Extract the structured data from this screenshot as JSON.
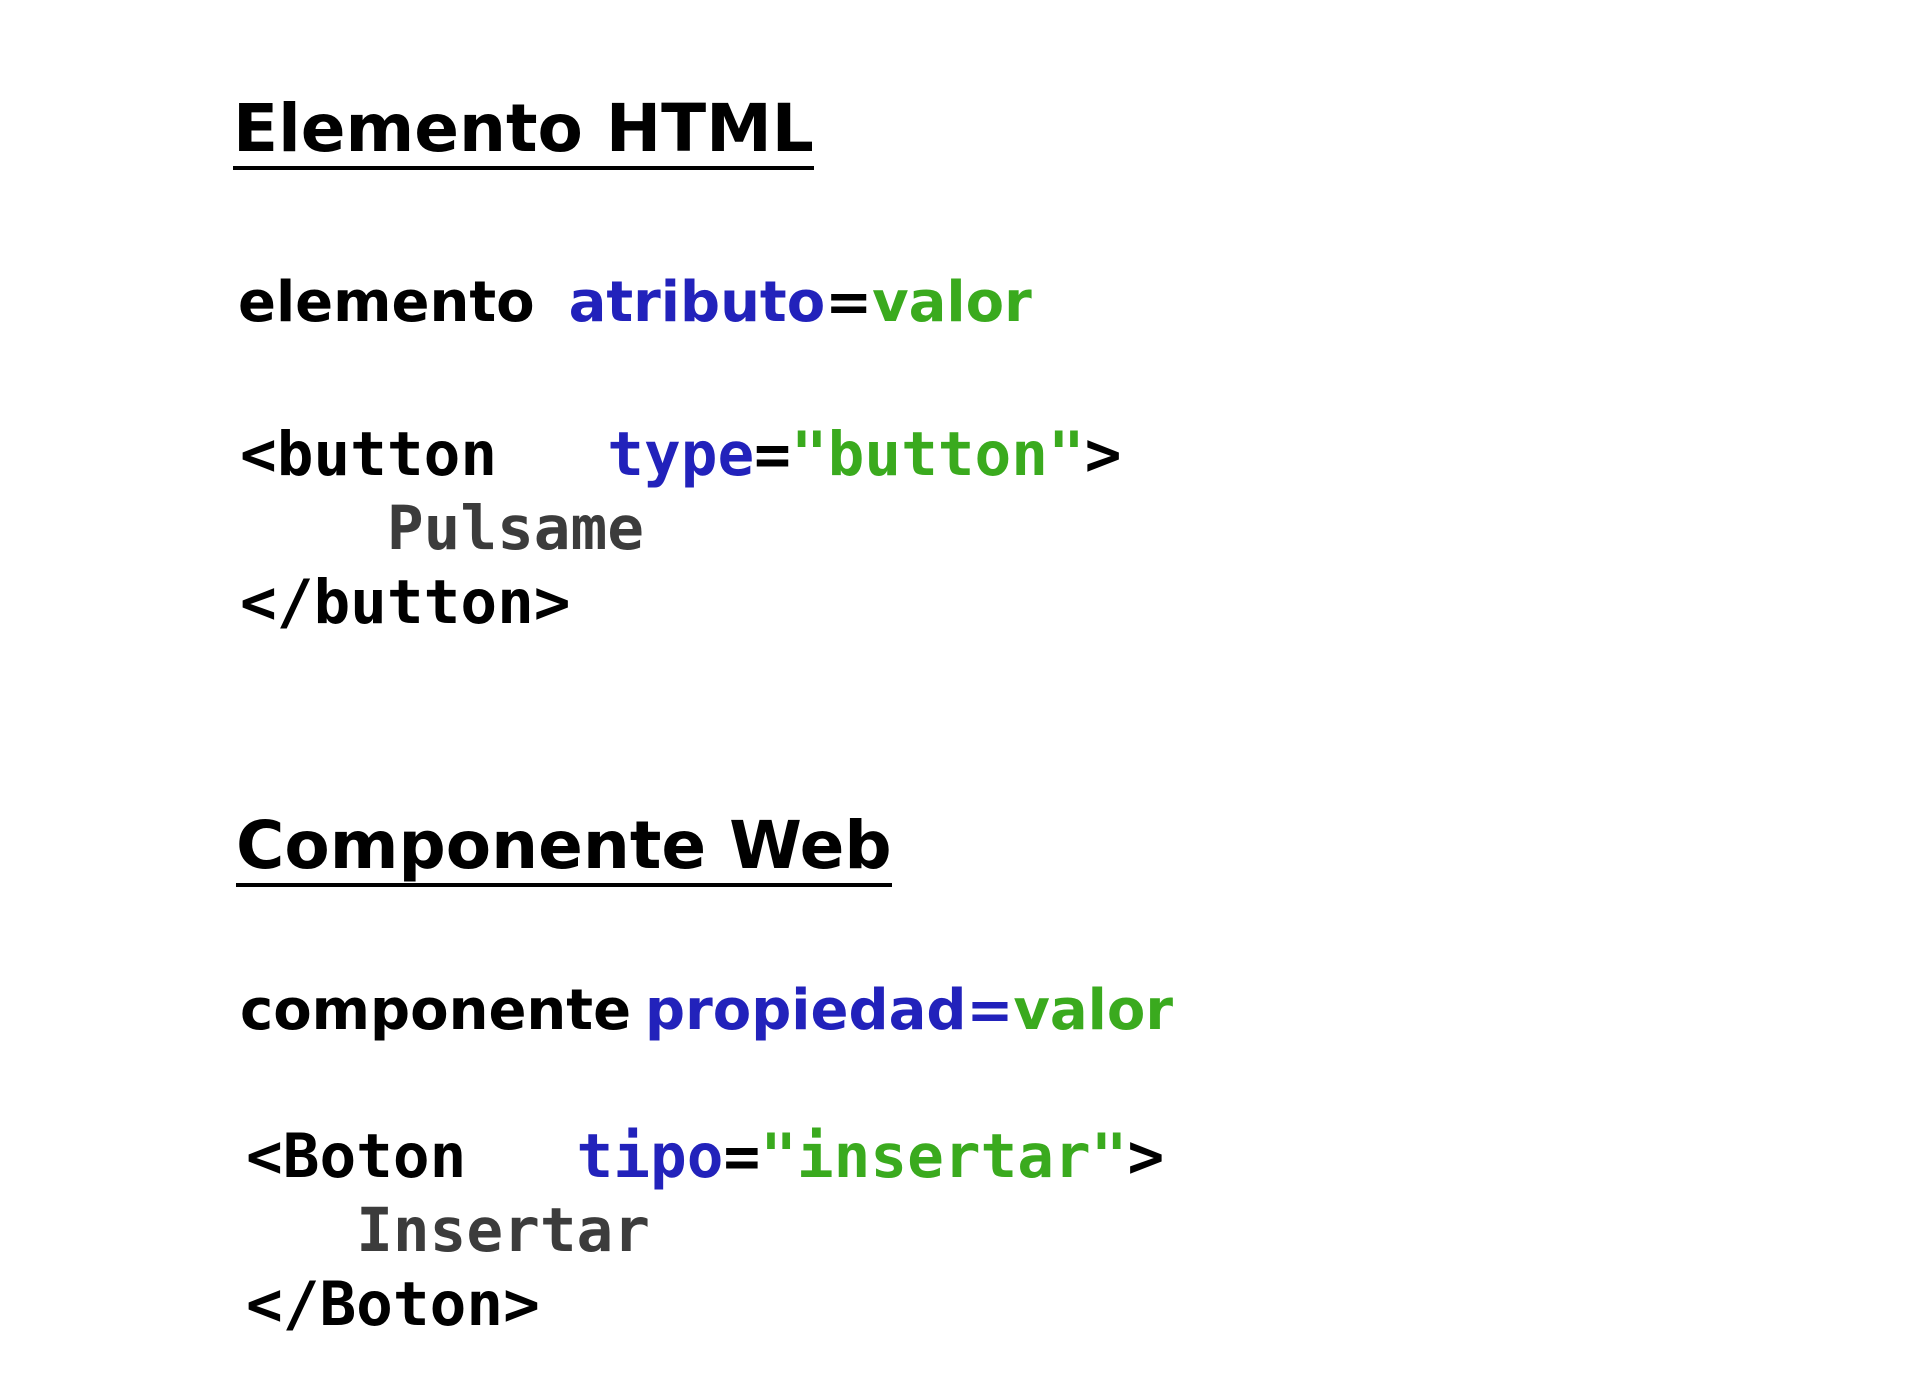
{
  "html_section": {
    "title": "Elemento HTML",
    "syntax": {
      "element": "elemento",
      "attribute": "atributo",
      "equals": "=",
      "value": "valor"
    },
    "code": {
      "open_tag": "<button",
      "attr_name": "type",
      "equals": "=",
      "attr_value": "\"button\"",
      "close_bracket": ">",
      "content": "Pulsame",
      "end_tag": "</button>"
    }
  },
  "web_section": {
    "title": "Componente Web",
    "syntax": {
      "component": "componente",
      "property": "propiedad=",
      "value": "valor"
    },
    "code": {
      "open_tag": "<Boton",
      "attr_name": "tipo",
      "equals": "=",
      "attr_value": "\"insertar\"",
      "close_bracket": ">",
      "content": "Insertar",
      "end_tag": "</Boton>"
    }
  },
  "colors": {
    "keyword": "#000000",
    "attribute": "#2222bb",
    "value": "#3aaa1e",
    "content": "#3c3c3c"
  }
}
